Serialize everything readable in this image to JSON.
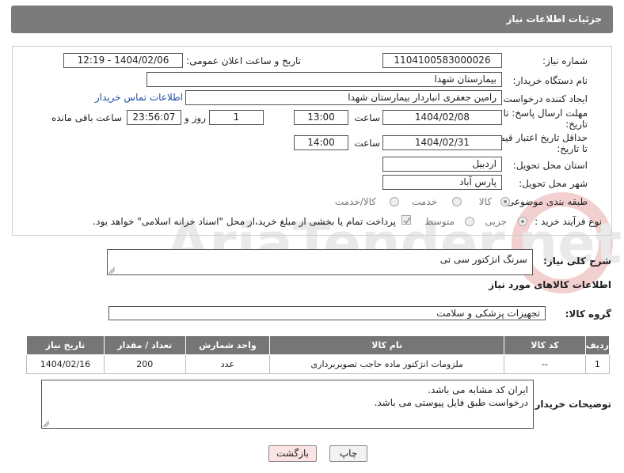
{
  "header": {
    "title": "جزئیات اطلاعات نیاز"
  },
  "form": {
    "need_number_label": "شماره نیاز:",
    "need_number": "1104100583000026",
    "announce_label": "تاریخ و ساعت اعلان عمومی:",
    "announce_value": "1404/02/06 - 12:19",
    "buyer_org_label": "نام دستگاه خریدار:",
    "buyer_org": "بیمارستان شهدا",
    "creator_label": "ایجاد کننده درخواست:",
    "creator": "رامین جعفری انباردار بیمارستان شهدا",
    "contact_link": "اطلاعات تماس خریدار",
    "reply_deadline_label_1": "مهلت ارسال پاسخ: تا",
    "reply_deadline_label_2": "تاریخ:",
    "reply_date": "1404/02/08",
    "time_label": "ساعت",
    "reply_time": "13:00",
    "days_value": "1",
    "days_label": "روز و",
    "remaining_time": "23:56:07",
    "remaining_label": "ساعت باقی مانده",
    "price_validity_label_1": "حداقل تاریخ اعتبار قیمت:",
    "price_validity_label_2": "تا تاریخ:",
    "price_date": "1404/02/31",
    "price_time": "14:00",
    "province_label": "استان محل تحویل:",
    "province": "اردبیل",
    "city_label": "شهر محل تحویل:",
    "city": "پارس آباد",
    "category_label": "طبقه بندی موضوعی:",
    "category_options": [
      "کالا",
      "خدمت",
      "کالا/خدمت"
    ],
    "process_label": "نوع فرآیند خرید :",
    "process_options": [
      "جزیی",
      "متوسط"
    ],
    "payment_note": "پرداخت تمام یا بخشی از مبلغ خرید،از محل \"اسناد خزانه اسلامی\" خواهد بود."
  },
  "description": {
    "label": "شرح کلی نیاز:",
    "value": "سرنگ انژکتور سی تی"
  },
  "goods": {
    "section_title": "اطلاعات کالاهای مورد نیاز",
    "group_label": "گروه کالا:",
    "group_value": "تجهیزات پزشکی و سلامت",
    "columns": [
      "ردیف",
      "کد کالا",
      "نام کالا",
      "واحد شمارش",
      "تعداد / مقدار",
      "تاریخ نیاز"
    ],
    "rows": [
      [
        "1",
        "--",
        "ملزومات انژکتور ماده حاجب تصویربرداری",
        "عدد",
        "200",
        "1404/02/16"
      ]
    ]
  },
  "buyer_notes": {
    "label": "توضیحات خریدار:",
    "line1": "ایران کد مشابه می باشد.",
    "line2": "درخواست طبق فایل پیوستی می باشد."
  },
  "buttons": {
    "print": "چاپ",
    "back": "بازگشت"
  },
  "colors": {
    "header_bg": "#7b7b7b",
    "table_header_bg": "#767676",
    "back_button_bg": "#fde4e4",
    "link": "#1a4fa0"
  }
}
